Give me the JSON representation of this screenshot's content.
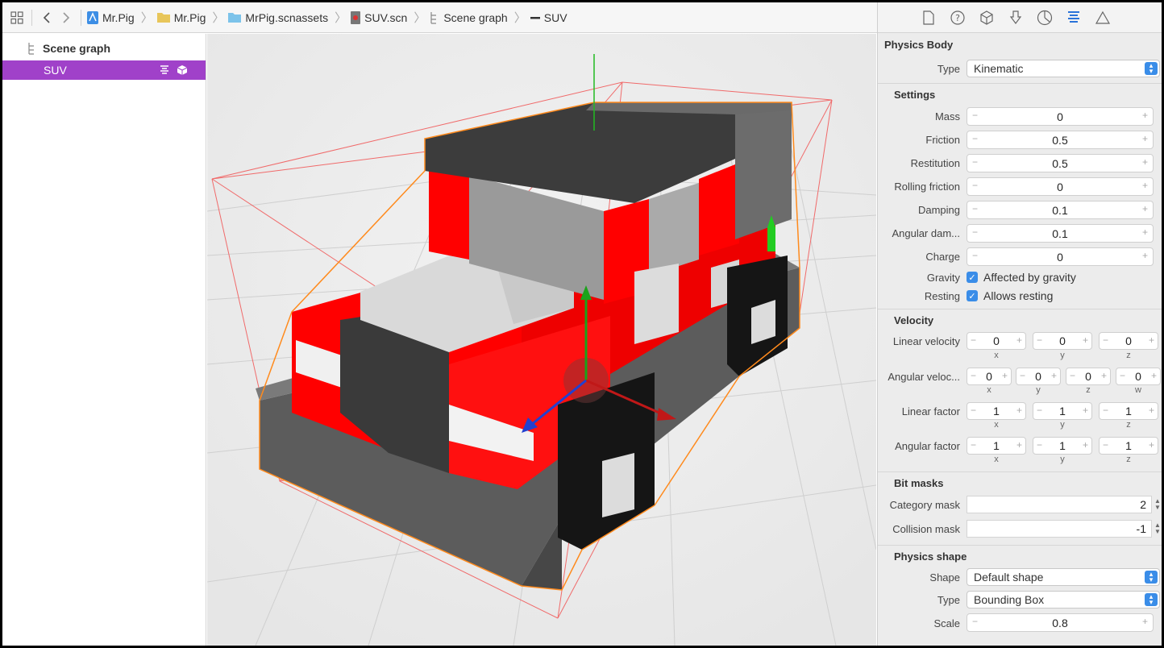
{
  "jumpbar": {
    "crumbs": [
      {
        "label": "Mr.Pig",
        "icon": "project-icon"
      },
      {
        "label": "Mr.Pig",
        "icon": "folder-icon"
      },
      {
        "label": "MrPig.scnassets",
        "icon": "folder-icon"
      },
      {
        "label": "SUV.scn",
        "icon": "scene-file-icon"
      },
      {
        "label": "Scene graph",
        "icon": "scene-graph-icon"
      },
      {
        "label": "SUV",
        "icon": "node-icon"
      }
    ]
  },
  "outline": {
    "header": "Scene graph",
    "selected_item": "SUV"
  },
  "inspector": {
    "physics_body": {
      "title": "Physics Body",
      "type_label": "Type",
      "type_value": "Kinematic"
    },
    "settings": {
      "title": "Settings",
      "mass_label": "Mass",
      "mass": "0",
      "friction_label": "Friction",
      "friction": "0.5",
      "restitution_label": "Restitution",
      "restitution": "0.5",
      "rolling_label": "Rolling friction",
      "rolling": "0",
      "damping_label": "Damping",
      "damping": "0.1",
      "angular_damping_label": "Angular dam...",
      "angular_damping": "0.1",
      "charge_label": "Charge",
      "charge": "0",
      "gravity_label": "Gravity",
      "gravity_text": "Affected by gravity",
      "resting_label": "Resting",
      "resting_text": "Allows resting"
    },
    "velocity": {
      "title": "Velocity",
      "linear_label": "Linear velocity",
      "linear": [
        "0",
        "0",
        "0"
      ],
      "angular_label": "Angular veloc...",
      "angular": [
        "0",
        "0",
        "0",
        "0"
      ],
      "linear_factor_label": "Linear factor",
      "linear_factor": [
        "1",
        "1",
        "1"
      ],
      "angular_factor_label": "Angular factor",
      "angular_factor": [
        "1",
        "1",
        "1"
      ],
      "axes3": [
        "x",
        "y",
        "z"
      ],
      "axes4": [
        "x",
        "y",
        "z",
        "w"
      ]
    },
    "bit_masks": {
      "title": "Bit masks",
      "category_label": "Category mask",
      "category": "2",
      "collision_label": "Collision mask",
      "collision": "-1"
    },
    "physics_shape": {
      "title": "Physics shape",
      "shape_label": "Shape",
      "shape_value": "Default shape",
      "type_label": "Type",
      "type_value": "Bounding Box",
      "scale_label": "Scale",
      "scale": "0.8"
    }
  },
  "colors": {
    "selection": "#a041c9",
    "accent": "#3a8de8",
    "car_red": "#ff0000",
    "bounding_box": "#f06a6a"
  }
}
